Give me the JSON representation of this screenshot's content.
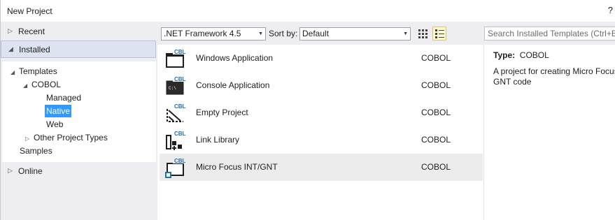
{
  "window": {
    "title": "New Project",
    "help": "?"
  },
  "nav": {
    "recent": "Recent",
    "installed": "Installed",
    "online": "Online",
    "tree": {
      "templates": "Templates",
      "cobol": "COBOL",
      "managed": "Managed",
      "native": "Native",
      "web": "Web",
      "other": "Other Project Types",
      "samples": "Samples"
    }
  },
  "toolbar": {
    "framework": ".NET Framework 4.5",
    "sort_label": "Sort by:",
    "sort_value": "Default",
    "search_placeholder": "Search Installed Templates (Ctrl+E)"
  },
  "templates": [
    {
      "name": "Windows Application",
      "lang": "COBOL",
      "icon": "windows-application-icon",
      "badge": "CBL"
    },
    {
      "name": "Console Application",
      "lang": "COBOL",
      "icon": "console-application-icon",
      "badge": "CBL"
    },
    {
      "name": "Empty Project",
      "lang": "COBOL",
      "icon": "empty-project-icon",
      "badge": "CBL"
    },
    {
      "name": "Link Library",
      "lang": "COBOL",
      "icon": "link-library-icon",
      "badge": "CBL"
    },
    {
      "name": "Micro Focus INT/GNT",
      "lang": "COBOL",
      "icon": "int-gnt-icon",
      "badge": "CBL",
      "selected": true
    }
  ],
  "description": {
    "type_label": "Type:",
    "type_value": "COBOL",
    "text": "A project for creating Micro Focus INT/\nGNT code"
  },
  "colors": {
    "selection": "#3399ff",
    "pane": "#eeeef2",
    "selected_row": "#ececec"
  }
}
